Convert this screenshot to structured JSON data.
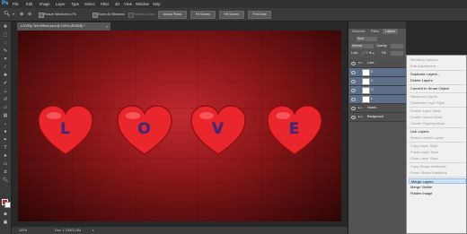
{
  "app": {
    "logo": "Ps"
  },
  "menu": [
    "File",
    "Edit",
    "Image",
    "Layer",
    "Type",
    "Select",
    "Filter",
    "3D",
    "View",
    "Window",
    "Help"
  ],
  "options": {
    "resize_windows": "Resize Windows to Fit",
    "zoom_all": "Zoom All Windows",
    "scrubby_zoom": "Scrubby Zoom",
    "actual_pixels": "Actual Pixels",
    "fit_screen": "Fit Screen",
    "fill_screen": "Fill Screen",
    "print_size": "Print Size"
  },
  "document": {
    "tab_title": "LOVEly Text Effect.psd @ 100% (RGB/8) *",
    "close": "×",
    "letters": [
      "L",
      "O",
      "V",
      "E"
    ],
    "zoom": "100%",
    "doc_info": "Doc: 1.70M/11.8M"
  },
  "panel": {
    "tabs": [
      "Channels",
      "Paths",
      "Layers"
    ],
    "kind": "Kind",
    "blend": "Normal",
    "opacity_label": "Opacity:",
    "lock_label": "Lock:",
    "fill_label": "Fill:",
    "layers": [
      "Love",
      "E",
      "V",
      "O",
      "L",
      "Hearts",
      "Background"
    ]
  },
  "context_menu": {
    "items": [
      "Blending Options...",
      "Edit Adjustment...",
      "Duplicate Layers...",
      "Delete Layers",
      "Convert to Smart Object",
      "Rasterize Layers",
      "Rasterize Layer Style",
      "Enable Layer Mask",
      "Enable Vector Mask",
      "Create Clipping Mask",
      "Link Layers",
      "Select Linked Layers",
      "Copy Layer Style",
      "Paste Layer Style",
      "Clear Layer Style",
      "Copy Shape Attributes",
      "Paste Shape Attributes",
      "Merge Layers",
      "Merge Visible",
      "Flatten Image"
    ]
  },
  "colors": {
    "foreground": "#d01c1c",
    "background": "#ffffff",
    "heart": "#e8262c",
    "letter": "#3d2a7c",
    "menu_highlight": "#cfe3f7"
  }
}
